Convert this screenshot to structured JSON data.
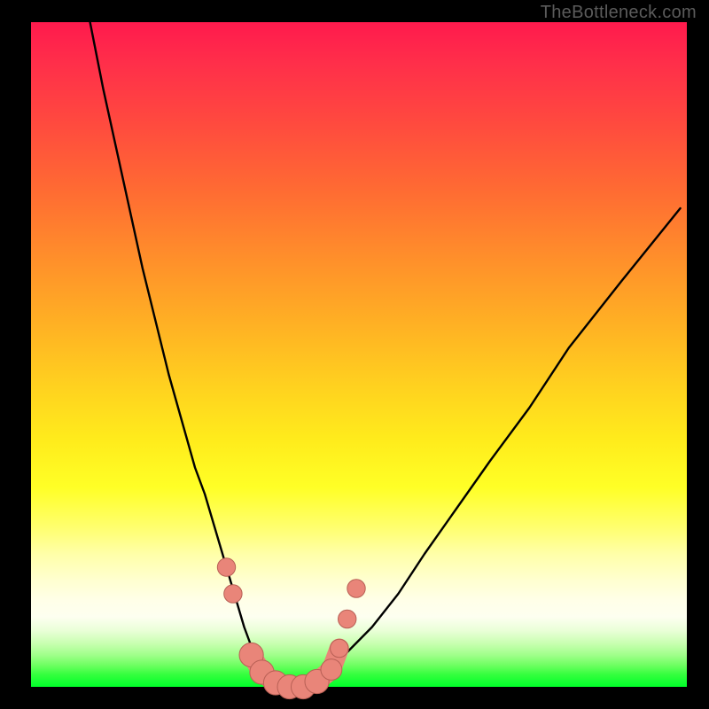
{
  "attribution": "TheBottleneck.com",
  "colors": {
    "frame_bg": "#000000",
    "curve_stroke": "#000000",
    "marker_fill": "#e98579",
    "marker_stroke": "#b86055"
  },
  "chart_data": {
    "type": "line",
    "title": "",
    "xlabel": "",
    "ylabel": "",
    "xlim": [
      0,
      100
    ],
    "ylim": [
      0,
      100
    ],
    "grid": false,
    "series": [
      {
        "name": "bottleneck-curve",
        "x": [
          9,
          11,
          13,
          15,
          17,
          19,
          21,
          23,
          25,
          26.5,
          28,
          29.5,
          31,
          32.5,
          34,
          36,
          39,
          42,
          45,
          48,
          52,
          56,
          60,
          65,
          70,
          76,
          82,
          90,
          99
        ],
        "y": [
          100,
          90,
          81,
          72,
          63,
          55,
          47,
          40,
          33,
          29,
          24,
          19,
          14,
          9,
          5,
          2,
          0,
          0,
          2,
          5,
          9,
          14,
          20,
          27,
          34,
          42,
          51,
          61,
          72
        ]
      }
    ],
    "markers": [
      {
        "name": "pt-left-upper",
        "x": 29.8,
        "y": 18,
        "r": 1.2
      },
      {
        "name": "pt-left-mid",
        "x": 30.8,
        "y": 14,
        "r": 1.2
      },
      {
        "name": "pt-left-low1",
        "x": 33.6,
        "y": 4.8,
        "r": 1.6
      },
      {
        "name": "pt-left-low2",
        "x": 35.2,
        "y": 2.2,
        "r": 1.6
      },
      {
        "name": "trough-1",
        "x": 37.3,
        "y": 0.6,
        "r": 1.6
      },
      {
        "name": "trough-2",
        "x": 39.4,
        "y": 0.0,
        "r": 1.6
      },
      {
        "name": "trough-3",
        "x": 41.5,
        "y": 0.0,
        "r": 1.6
      },
      {
        "name": "trough-4",
        "x": 43.6,
        "y": 0.8,
        "r": 1.6
      },
      {
        "name": "pt-right-low",
        "x": 45.8,
        "y": 2.6,
        "r": 1.4
      },
      {
        "name": "pt-right-mid1",
        "x": 47.0,
        "y": 5.8,
        "r": 1.2
      },
      {
        "name": "pt-right-mid2",
        "x": 48.2,
        "y": 10.2,
        "r": 1.2
      },
      {
        "name": "pt-right-upper",
        "x": 49.6,
        "y": 14.8,
        "r": 1.2
      }
    ]
  }
}
